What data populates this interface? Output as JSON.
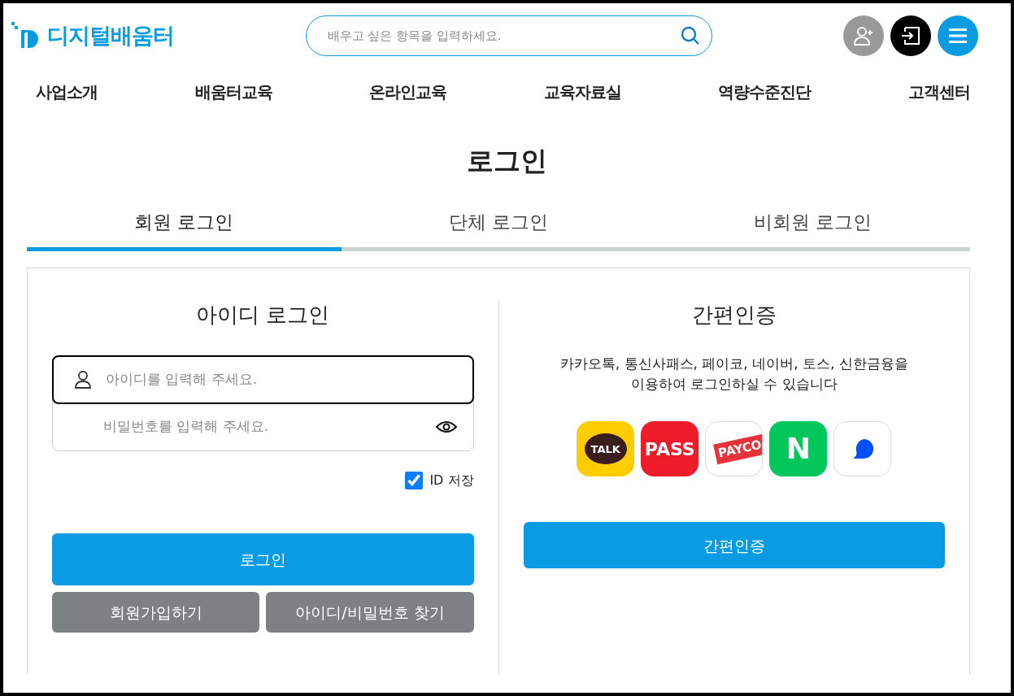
{
  "header": {
    "logo_text": "디지털배움터",
    "search": {
      "placeholder": "배우고 싶은 항목을 입력하세요."
    },
    "icon_buttons": [
      {
        "kind": "signup"
      },
      {
        "kind": "login"
      },
      {
        "kind": "menu"
      }
    ]
  },
  "nav": [
    "사업소개",
    "배움터교육",
    "온라인교육",
    "교육자료실",
    "역량수준진단",
    "고객센터"
  ],
  "page_title": "로그인",
  "tabs": [
    {
      "label": "회원 로그인",
      "selected": true
    },
    {
      "label": "단체 로그인",
      "selected": false
    },
    {
      "label": "비회원 로그인",
      "selected": false
    }
  ],
  "id_login": {
    "title": "아이디 로그인",
    "id_field": {
      "placeholder": "아이디를 입력해 주세요."
    },
    "password_field": {
      "placeholder": "비밀번호를 입력해 주세요."
    },
    "save_id": {
      "label": "ID 저장",
      "checked": true
    },
    "login_button": "로그인",
    "signup_button": "회원가입하기",
    "find_button": "아이디/비밀번호 찾기"
  },
  "easy_auth": {
    "title": "간편인증",
    "description": "카카오톡, 통신사패스, 페이코, 네이버, 토스, 신한금융을\n이용하여 로그인하실 수 있습니다",
    "providers": [
      {
        "kind": "kakao",
        "label": "TALK"
      },
      {
        "kind": "pass",
        "label": "PASS"
      },
      {
        "kind": "payco",
        "label": "PAYCO"
      },
      {
        "kind": "naver",
        "label": "N"
      },
      {
        "kind": "toss"
      }
    ],
    "button": "간편인증"
  }
}
